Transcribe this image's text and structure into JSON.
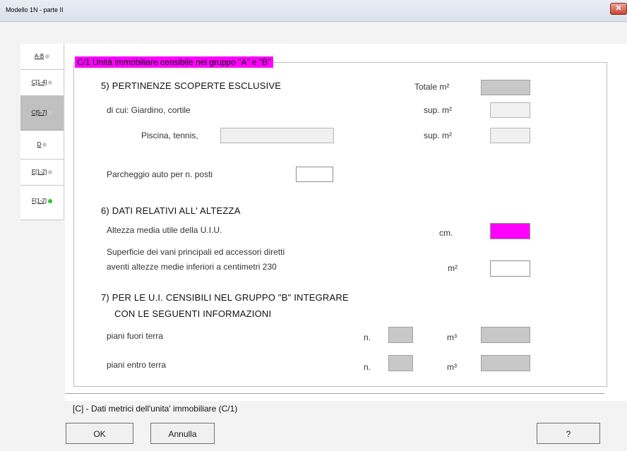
{
  "window": {
    "title": "Modello 1N  -  parte II",
    "close_glyph": "✕"
  },
  "tabs": [
    {
      "label": "A-B",
      "status": "grey"
    },
    {
      "label": "C[1-4]",
      "status": "grey"
    },
    {
      "label": "C[5-7]",
      "status": "grey",
      "selected": true
    },
    {
      "label": "D",
      "status": "grey"
    },
    {
      "label": "E[1-2]",
      "status": "grey"
    },
    {
      "label": "F[1-2]",
      "status": "green"
    }
  ],
  "group_title": "C/1  Unità immobiliare censibile nel gruppo \"A\" e \"B\"",
  "section5": {
    "title": "5) PERTINENZE SCOPERTE ESCLUSIVE",
    "totale_label": "Totale m²",
    "di_cui_label": "di cui:  Giardino, cortile",
    "sup_label_1": "sup. m²",
    "piscina_label": "Piscina, tennis,",
    "sup_label_2": "sup. m²",
    "parcheggio_label": "Parcheggio auto per n. posti"
  },
  "section6": {
    "title": "6) DATI RELATIVI ALL' ALTEZZA",
    "altezza_label": "Altezza media utile della U.I.U.",
    "cm_label": "cm.",
    "superficie_line1": "Superficie dei vani principali ed accessori diretti",
    "superficie_line2": "aventi altezze medie inferiori a centimetri 230",
    "m2_label": "m²"
  },
  "section7": {
    "title_line1": "7) PER LE U.I. CENSIBILI NEL GRUPPO \"B\" INTEGRARE",
    "title_line2": "CON LE SEGUENTI INFORMAZIONI",
    "fuori_label": "piani fuori terra",
    "entro_label": "piani entro terra",
    "n_label": "n.",
    "m3_label": "m³"
  },
  "footer": {
    "description": "[C] - Dati metrici dell'unita' immobiliare (C/1)"
  },
  "buttons": {
    "ok": "OK",
    "annulla": "Annulla",
    "help": "?"
  },
  "colors": {
    "highlight": "#ff00ff",
    "status_green": "#22cc22",
    "status_grey": "#c9c9c9"
  }
}
